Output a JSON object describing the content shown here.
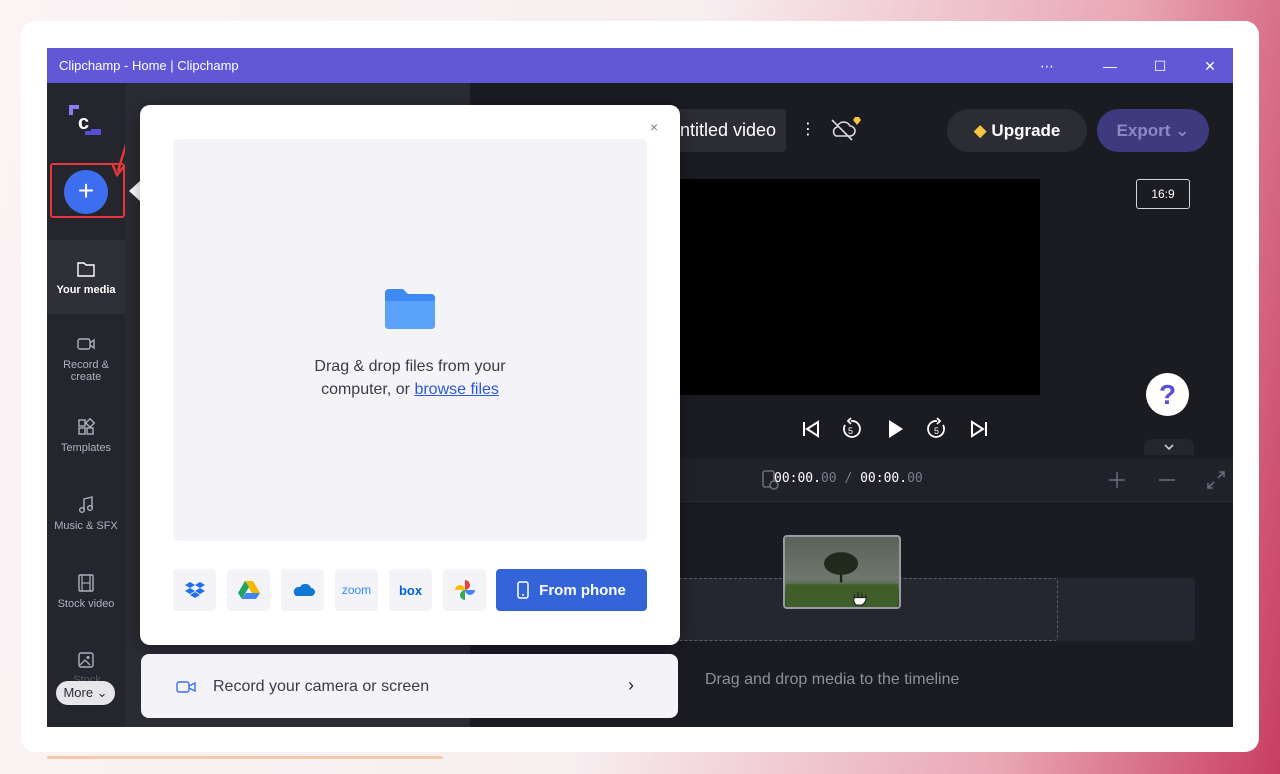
{
  "window": {
    "title": "Clipchamp - Home | Clipchamp"
  },
  "titlebar": {
    "more": "⋯",
    "minimize": "—",
    "maximize": "☐",
    "close": "✕"
  },
  "sidebar": {
    "add_label": "+",
    "items": [
      {
        "label": "Your media",
        "icon": "folder-icon"
      },
      {
        "label": "Record & create",
        "icon": "camera-icon"
      },
      {
        "label": "Templates",
        "icon": "templates-icon"
      },
      {
        "label": "Music & SFX",
        "icon": "music-icon"
      },
      {
        "label": "Stock video",
        "icon": "film-icon"
      },
      {
        "label": "Stock images",
        "icon": "image-icon"
      }
    ],
    "more_label": "More ⌄"
  },
  "editor": {
    "project_name": "ntitled video",
    "project_menu": "⋮",
    "upgrade_label": "Upgrade",
    "export_label": "Export ⌄",
    "aspect_ratio": "16:9",
    "help_label": "?",
    "timecode_current": "00:00.",
    "timecode_current_frac": "00",
    "timecode_sep": " / ",
    "timecode_total": "00:00.",
    "timecode_total_frac": "00",
    "drop_hint": "Drag and drop media to the timeline"
  },
  "import_popup": {
    "close": "×",
    "drop_text_1": "Drag & drop files from your",
    "drop_text_2": "computer, or ",
    "browse_link": "browse files",
    "sources": [
      "dropbox-icon",
      "google-drive-icon",
      "onedrive-icon",
      "zoom",
      "box",
      "google-photos-icon"
    ],
    "zoom_label": "zoom",
    "box_label": "box",
    "from_phone_label": "From phone",
    "record_label": "Record your camera or screen",
    "record_chevron": "›"
  },
  "colors": {
    "accent": "#3d6ef0",
    "titlebar": "#6158d8",
    "highlight": "#e5383b",
    "gem": "#f5c542"
  }
}
